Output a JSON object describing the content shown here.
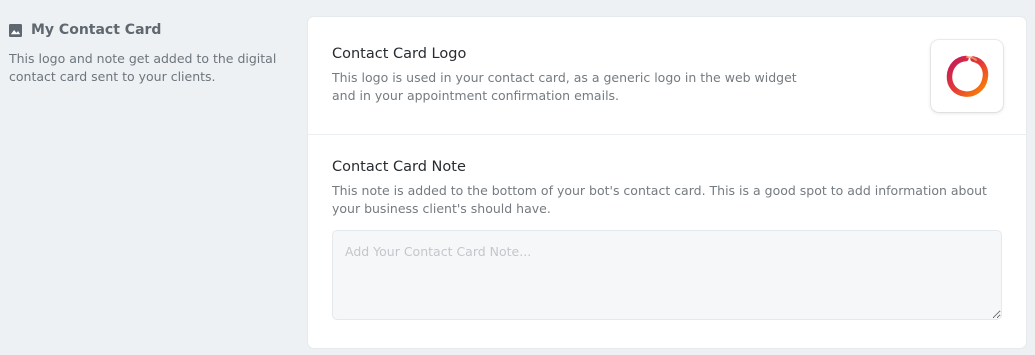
{
  "section": {
    "title": "My Contact Card",
    "icon": "image-icon",
    "description": "This logo and note get added to the digital contact card sent to your clients."
  },
  "logo": {
    "title": "Contact Card Logo",
    "description": "This logo is used in your contact card, as a generic logo in the web widget and in your appointment confirmation emails.",
    "image_icon": "enso-circle-logo",
    "logo_colors": [
      "#c2185b",
      "#e53935",
      "#fb8c00"
    ]
  },
  "note": {
    "title": "Contact Card Note",
    "description": "This note is added to the bottom of your bot's contact card. This is a good spot to add information about your business client's should have.",
    "placeholder": "Add Your Contact Card Note...",
    "value": ""
  },
  "colors": {
    "background": "#eef1f3",
    "card": "#ffffff",
    "heading": "#5f6870"
  }
}
